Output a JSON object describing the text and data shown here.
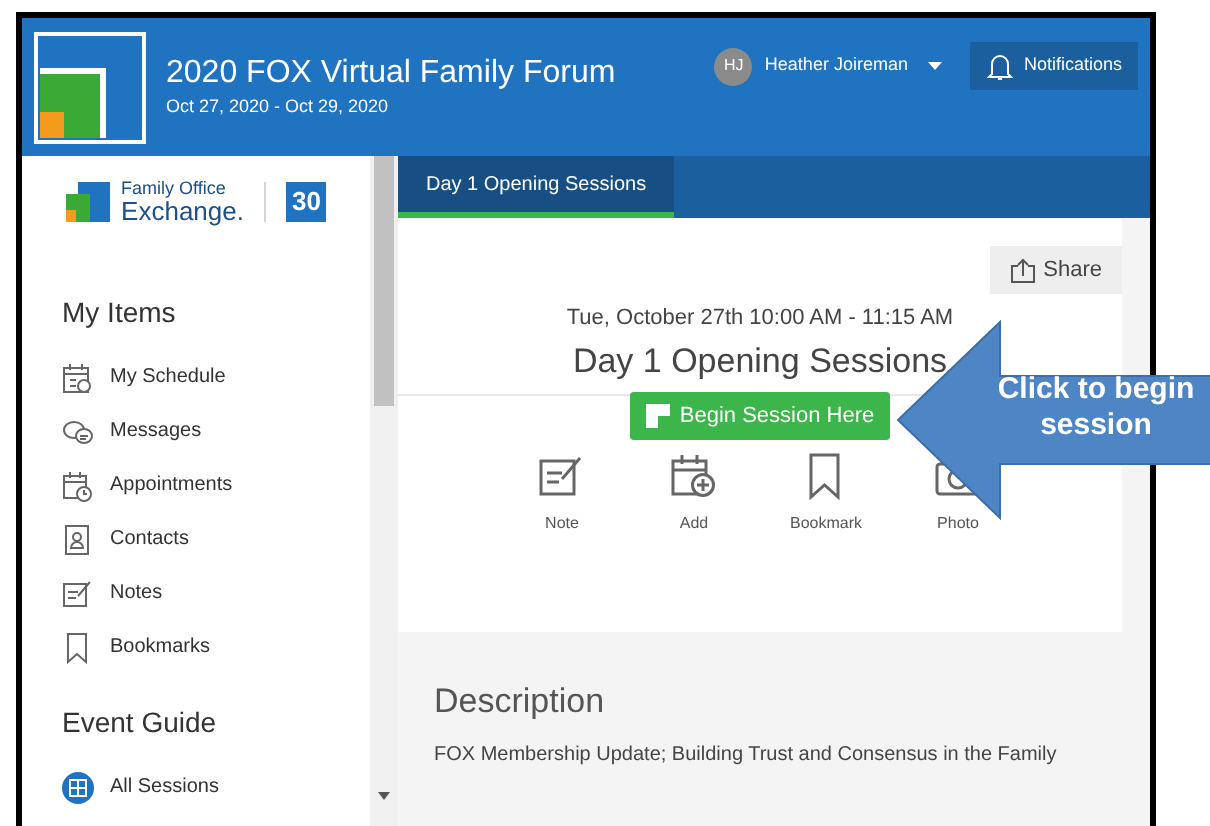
{
  "header": {
    "title": "2020 FOX Virtual Family Forum",
    "dates": "Oct 27, 2020 - Oct 29, 2020",
    "user": {
      "initials": "HJ",
      "name": "Heather Joireman"
    },
    "notifications": "Notifications"
  },
  "sidebar": {
    "logo": {
      "line1": "Family Office",
      "line2": "Exchange.",
      "badge": "30"
    },
    "sections": [
      {
        "title": "My Items",
        "items": [
          {
            "label": "My Schedule"
          },
          {
            "label": "Messages"
          },
          {
            "label": "Appointments"
          },
          {
            "label": "Contacts"
          },
          {
            "label": "Notes"
          },
          {
            "label": "Bookmarks"
          }
        ]
      },
      {
        "title": "Event Guide",
        "items": [
          {
            "label": "All Sessions"
          }
        ]
      }
    ]
  },
  "tabs": [
    {
      "label": "Day 1 Opening Sessions",
      "selected": true
    }
  ],
  "session": {
    "share": "Share",
    "time": "Tue, October 27th 10:00 AM - 11:15 AM",
    "title": "Day 1 Opening Sessions",
    "begin_button": "Begin Session Here",
    "actions": [
      {
        "label": "Note"
      },
      {
        "label": "Add"
      },
      {
        "label": "Bookmark"
      },
      {
        "label": "Photo"
      }
    ]
  },
  "description": {
    "heading": "Description",
    "text": "FOX Membership Update; Building Trust and Consensus in the Family"
  },
  "callout": {
    "text": "Click to begin session"
  }
}
